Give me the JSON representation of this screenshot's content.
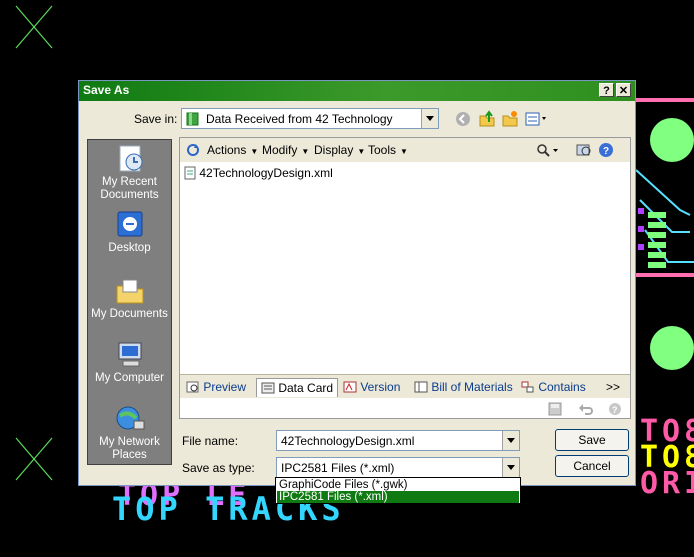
{
  "background": {
    "top_tracks": "TOP TRACKS",
    "top_left_partial": "TOP LE",
    "right_text_1": "TO8",
    "right_text_2": "TO8",
    "right_text_3": "ORI"
  },
  "dialog": {
    "title": "Save As",
    "help_glyph": "?",
    "close_glyph": "✕",
    "save_in_label": "Save in:",
    "save_in_value": "Data Received from 42 Technology",
    "places": [
      {
        "label": "My Recent Documents",
        "icon": "recent-documents-icon"
      },
      {
        "label": "Desktop",
        "icon": "desktop-icon"
      },
      {
        "label": "My Documents",
        "icon": "my-documents-icon"
      },
      {
        "label": "My Computer",
        "icon": "my-computer-icon"
      },
      {
        "label": "My Network Places",
        "icon": "network-places-icon"
      }
    ],
    "toolbar": {
      "actions": "Actions",
      "modify": "Modify",
      "display": "Display",
      "tools": "Tools"
    },
    "files": [
      "42TechnologyDesign.xml"
    ],
    "tabs": [
      "Preview",
      "Data Card",
      "Version",
      "Bill of Materials",
      "Contains",
      ">>"
    ],
    "active_tab": "Data Card",
    "file_name_label": "File name:",
    "file_name_value": "42TechnologyDesign.xml",
    "save_as_type_label": "Save as type:",
    "save_as_type_value": "IPC2581 Files (*.xml)",
    "save_button": "Save",
    "cancel_button": "Cancel",
    "type_options": [
      "GraphiCode Files (*.gwk)",
      "IPC2581 Files (*.xml)"
    ],
    "selected_option": "IPC2581 Files (*.xml)"
  },
  "colors": {
    "title_bar": "#0f7a12",
    "selection": "#0f7a12",
    "cad_cyan": "#33d6ff",
    "cad_magenta": "#ff5aa8",
    "cad_yellow": "#ffff00",
    "cad_green": "#80ff80"
  }
}
